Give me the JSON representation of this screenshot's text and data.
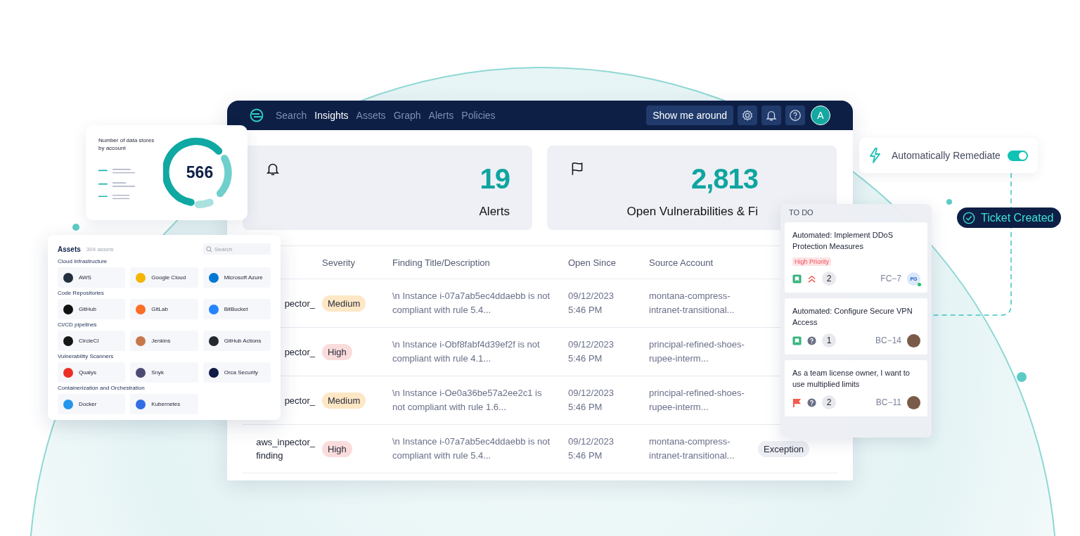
{
  "nav": {
    "items": [
      {
        "label": "Search",
        "selected": false
      },
      {
        "label": "Insights",
        "selected": true
      },
      {
        "label": "Assets",
        "selected": false
      },
      {
        "label": "Graph",
        "selected": false
      },
      {
        "label": "Alerts",
        "selected": false
      },
      {
        "label": "Policies",
        "selected": false
      }
    ],
    "tour_button": "Show me around",
    "avatar": "A"
  },
  "stats": [
    {
      "value": "19",
      "label": "Alerts"
    },
    {
      "value": "2,813",
      "label": "Open Vulnerabilities & Fi"
    }
  ],
  "table": {
    "columns": [
      "Severity",
      "Finding Title/Description",
      "Open Since",
      "Source Account"
    ],
    "rows": [
      {
        "column_1": "pector_",
        "severity": {
          "label": "Medium",
          "kind": "medium"
        },
        "finding": "\\n Instance i-07a7ab5ec4ddaebb is not compliant with rule 5.4...",
        "open_since": "09/12/2023 5:46 PM",
        "source_account": "montana-compress-intranet-transitional..."
      },
      {
        "column_1": "pector_",
        "severity": {
          "label": "High",
          "kind": "high"
        },
        "finding": "\\n Instance i-Obf8fabf4d39ef2f is not compliant with rule 4.1...",
        "open_since": "09/12/2023 5:46 PM",
        "source_account": "principal-refined-shoes-rupee-interm..."
      },
      {
        "column_1": "pector_",
        "severity": {
          "label": "Medium",
          "kind": "medium"
        },
        "finding": "\\n Instance i-Oe0a36be57a2ee2c1 is not compliant with rule 1.6...",
        "open_since": "09/12/2023 5:46 PM",
        "source_account": "principal-refined-shoes-rupee-interm..."
      },
      {
        "column_1": "aws_inpector_ finding",
        "severity": {
          "label": "High",
          "kind": "high"
        },
        "finding": "\\n Instance i-07a7ab5ec4ddaebb is not compliant with rule 5.4...",
        "open_since": "09/12/2023 5:46 PM",
        "source_account": "montana-compress-intranet-transitional...",
        "status": "Exception"
      }
    ]
  },
  "data_stores": {
    "title": "Number of data stores by account",
    "value": "566"
  },
  "assets": {
    "title": "Assets",
    "count": "304 assets",
    "search": {
      "placeholder": "Search"
    },
    "groups": [
      {
        "title": "Cloud Infrastructure",
        "items": [
          "AWS",
          "Google Cloud",
          "Microsoft Azure"
        ]
      },
      {
        "title": "Code Repositories",
        "items": [
          "GitHub",
          "GitLab",
          "BitBucket"
        ]
      },
      {
        "title": "CI/CD pipelines",
        "items": [
          "CircleCI",
          "Jenkins",
          "GitHub Actions"
        ]
      },
      {
        "title": "Vulnerability Scanners",
        "items": [
          "Qualys",
          "Snyk",
          "Orca Security"
        ]
      },
      {
        "title": "Containerization and Orchestration",
        "items": [
          "Docker",
          "Kubernetes"
        ]
      }
    ]
  },
  "remediate": {
    "label": "Automatically Remediate",
    "on": true
  },
  "ticket": {
    "label": "Ticket Created"
  },
  "todo": {
    "title": "TO DO",
    "cards": [
      {
        "title": "Automated: Implement DDoS Protection Measures",
        "tag": "High Priority",
        "count": "2",
        "key": "FC−7",
        "assignee": {
          "kind": "initials",
          "initials": "PG",
          "online": true
        }
      },
      {
        "title": "Automated: Configure Secure VPN Access",
        "count": "1",
        "key": "BC−14",
        "assignee": {
          "kind": "photo"
        }
      },
      {
        "title": "As a team license owner, I want to use multiplied limits",
        "count": "2",
        "key": "BC−11",
        "assignee": {
          "kind": "photo"
        }
      }
    ]
  }
}
